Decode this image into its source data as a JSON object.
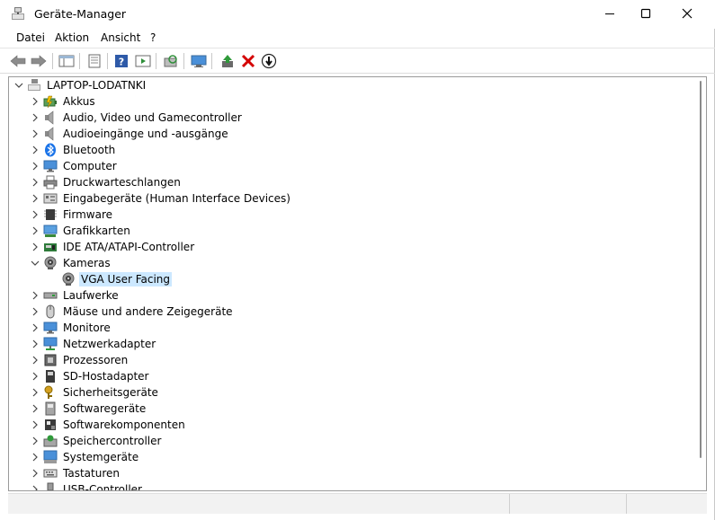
{
  "window": {
    "title": "Geräte-Manager"
  },
  "menu": [
    {
      "name": "menu-datei",
      "label": "Datei"
    },
    {
      "name": "menu-aktion",
      "label": "Aktion"
    },
    {
      "name": "menu-ansicht",
      "label": "Ansicht"
    },
    {
      "name": "menu-help",
      "label": "?"
    }
  ],
  "toolbar": {
    "icons": [
      "back-arrow-icon",
      "forward-arrow-icon",
      "show-hide-console-tree-icon",
      "properties-icon",
      "help-icon",
      "run-action-icon",
      "scan-hardware-icon",
      "monitor-icon",
      "update-driver-icon",
      "uninstall-device-icon",
      "disable-device-icon"
    ]
  },
  "tree": {
    "root": {
      "label": "LAPTOP-LODATNKI",
      "icon": "computer-root-icon"
    },
    "categories": [
      {
        "label": "Akkus",
        "icon": "battery-icon",
        "expanded": false
      },
      {
        "label": "Audio, Video und Gamecontroller",
        "icon": "speaker-icon",
        "expanded": false
      },
      {
        "label": "Audioeingänge und -ausgänge",
        "icon": "speaker-icon",
        "expanded": false
      },
      {
        "label": "Bluetooth",
        "icon": "bluetooth-icon",
        "expanded": false
      },
      {
        "label": "Computer",
        "icon": "monitor-icon",
        "expanded": false
      },
      {
        "label": "Druckwarteschlangen",
        "icon": "printer-icon",
        "expanded": false
      },
      {
        "label": "Eingabegeräte (Human Interface Devices)",
        "icon": "hid-icon",
        "expanded": false
      },
      {
        "label": "Firmware",
        "icon": "chip-icon",
        "expanded": false
      },
      {
        "label": "Grafikkarten",
        "icon": "display-adapter-icon",
        "expanded": false
      },
      {
        "label": "IDE ATA/ATAPI-Controller",
        "icon": "ide-controller-icon",
        "expanded": false
      },
      {
        "label": "Kameras",
        "icon": "camera-icon",
        "expanded": true,
        "children": [
          {
            "label": "VGA User Facing",
            "icon": "camera-icon",
            "selected": true
          }
        ]
      },
      {
        "label": "Laufwerke",
        "icon": "drive-icon",
        "expanded": false
      },
      {
        "label": "Mäuse und andere Zeigegeräte",
        "icon": "mouse-icon",
        "expanded": false
      },
      {
        "label": "Monitore",
        "icon": "monitor-icon",
        "expanded": false
      },
      {
        "label": "Netzwerkadapter",
        "icon": "network-icon",
        "expanded": false
      },
      {
        "label": "Prozessoren",
        "icon": "processor-icon",
        "expanded": false
      },
      {
        "label": "SD-Hostadapter",
        "icon": "sd-card-icon",
        "expanded": false
      },
      {
        "label": "Sicherheitsgeräte",
        "icon": "key-icon",
        "expanded": false
      },
      {
        "label": "Softwaregeräte",
        "icon": "software-device-icon",
        "expanded": false
      },
      {
        "label": "Softwarekomponenten",
        "icon": "software-component-icon",
        "expanded": false
      },
      {
        "label": "Speichercontroller",
        "icon": "storage-controller-icon",
        "expanded": false
      },
      {
        "label": "Systemgeräte",
        "icon": "system-devices-icon",
        "expanded": false
      },
      {
        "label": "Tastaturen",
        "icon": "keyboard-icon",
        "expanded": false
      },
      {
        "label": "USB-Controller",
        "icon": "usb-icon",
        "expanded": false
      }
    ]
  },
  "colors": {
    "selection": "#cce8ff",
    "accent": "#0078d4"
  }
}
